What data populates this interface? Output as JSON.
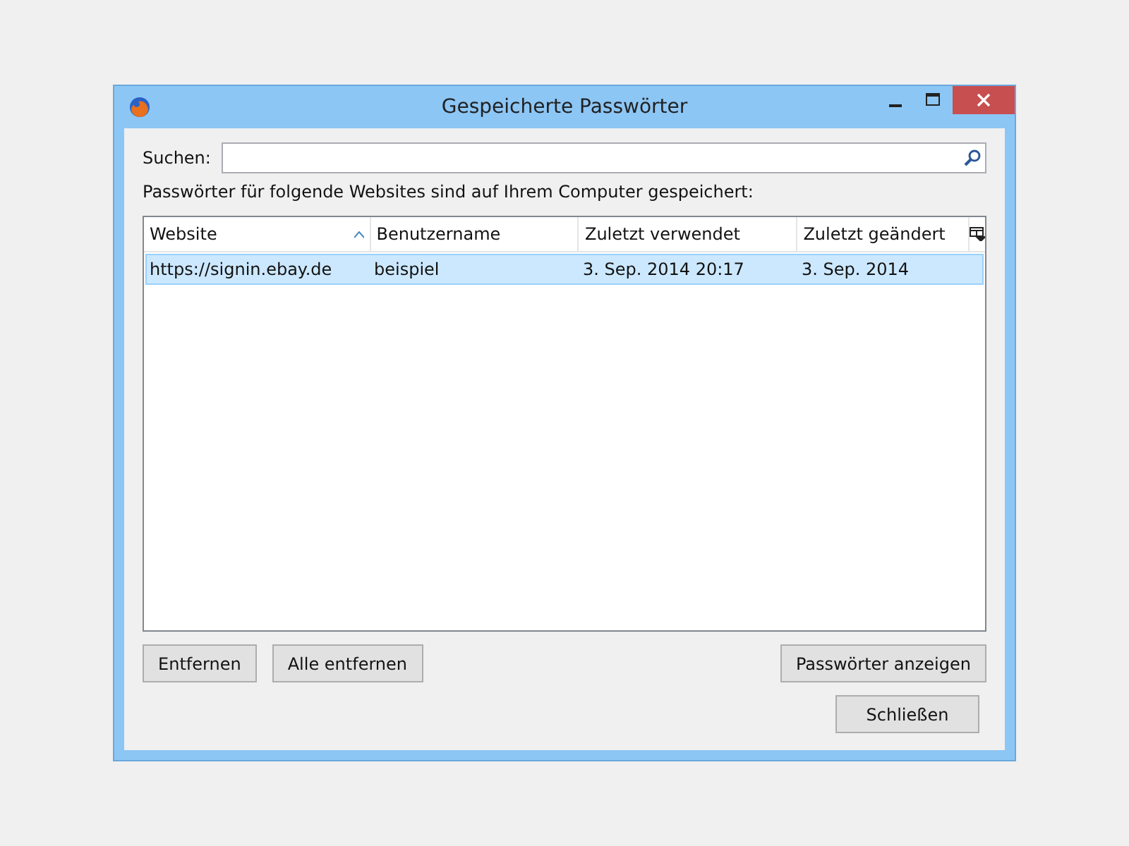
{
  "window": {
    "title": "Gespeicherte Passwörter"
  },
  "search": {
    "label": "Suchen:"
  },
  "description": "Passwörter für folgende Websites sind auf Ihrem Computer gespeichert:",
  "table": {
    "columns": [
      {
        "label": "Website",
        "sorted": true
      },
      {
        "label": "Benutzername",
        "sorted": false
      },
      {
        "label": "Zuletzt verwendet",
        "sorted": false
      },
      {
        "label": "Zuletzt geändert",
        "sorted": false
      }
    ],
    "rows": [
      {
        "cells": [
          "https://signin.ebay.de",
          "beispiel",
          "3. Sep. 2014 20:17",
          "3. Sep. 2014"
        ],
        "selected": true
      }
    ]
  },
  "buttons": {
    "left": [
      "Entfernen",
      "Alle entfernen"
    ],
    "right": "Passwörter anzeigen",
    "close": "Schließen"
  }
}
